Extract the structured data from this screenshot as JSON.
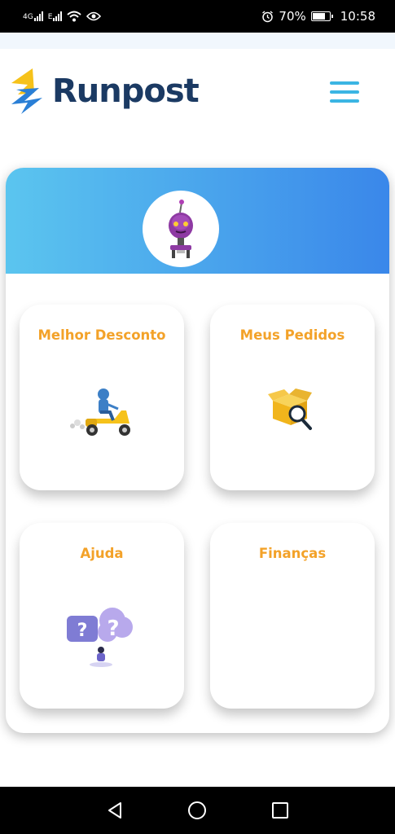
{
  "status_bar": {
    "net_1": "4G",
    "net_2": "E",
    "battery": "70%",
    "time": "10:58"
  },
  "header": {
    "app_name": "Runpost"
  },
  "cards": [
    {
      "title": "Melhor Desconto",
      "icon": "scooter-delivery-icon"
    },
    {
      "title": "Meus Pedidos",
      "icon": "box-search-icon"
    },
    {
      "title": "Ajuda",
      "icon": "help-question-icon"
    },
    {
      "title": "Finanças",
      "icon": ""
    }
  ],
  "colors": {
    "accent_orange": "#f3a229",
    "brand_navy": "#1b3a63",
    "menu_blue": "#3bb5e3",
    "banner_start": "#5bc5ef",
    "banner_end": "#3a87ea"
  }
}
